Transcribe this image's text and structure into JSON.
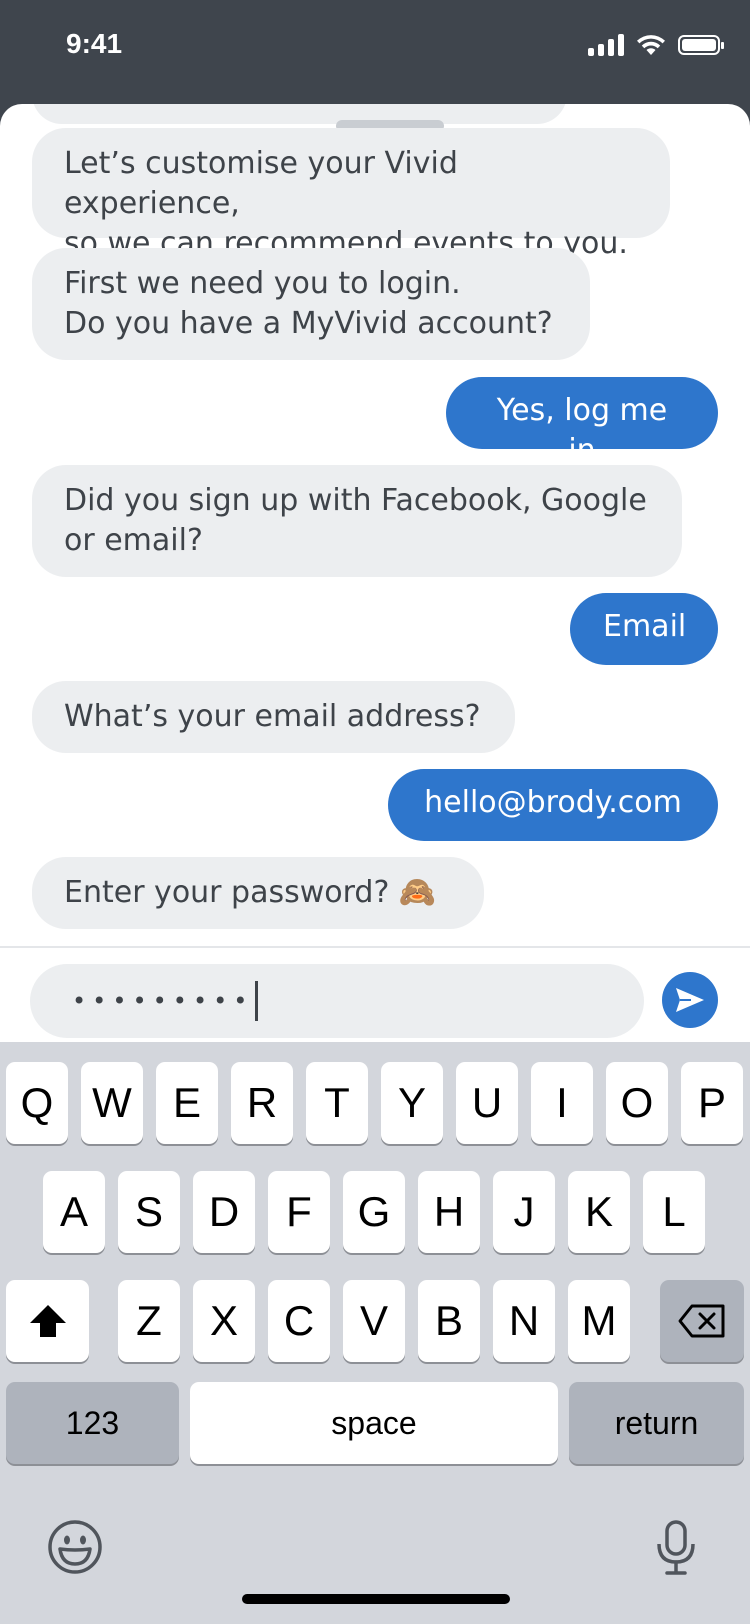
{
  "status_bar": {
    "time": "9:41"
  },
  "chat": {
    "messages": [
      {
        "from": "bot",
        "text": "Let’s customise your Vivid experience,\nso we can recommend events to you."
      },
      {
        "from": "bot",
        "text": "First we need you to login.\nDo you have a MyVivid account?"
      },
      {
        "from": "user",
        "text": "Yes, log me in"
      },
      {
        "from": "bot",
        "text": "Did you sign up with Facebook, Google\nor email?"
      },
      {
        "from": "user",
        "text": "Email"
      },
      {
        "from": "bot",
        "text": "What’s your email address?"
      },
      {
        "from": "user",
        "text": "hello@brody.com"
      },
      {
        "from": "bot",
        "text": "Enter your password?  🙈"
      }
    ]
  },
  "input": {
    "value": "•••••••••"
  },
  "keyboard": {
    "row1": [
      "Q",
      "W",
      "E",
      "R",
      "T",
      "Y",
      "U",
      "I",
      "O",
      "P"
    ],
    "row2": [
      "A",
      "S",
      "D",
      "F",
      "G",
      "H",
      "J",
      "K",
      "L"
    ],
    "row3": [
      "Z",
      "X",
      "C",
      "V",
      "B",
      "N",
      "M"
    ],
    "numbers_label": "123",
    "space_label": "space",
    "return_label": "return"
  },
  "colors": {
    "accent": "#2E76CC",
    "bot_bubble": "#ECEEF0",
    "header": "#3F454D",
    "keyboard_bg": "#D3D6DC"
  },
  "icons": {
    "send": "send-icon",
    "shift": "shift-icon",
    "backspace": "backspace-icon",
    "emoji": "emoji-icon",
    "mic": "microphone-icon"
  }
}
